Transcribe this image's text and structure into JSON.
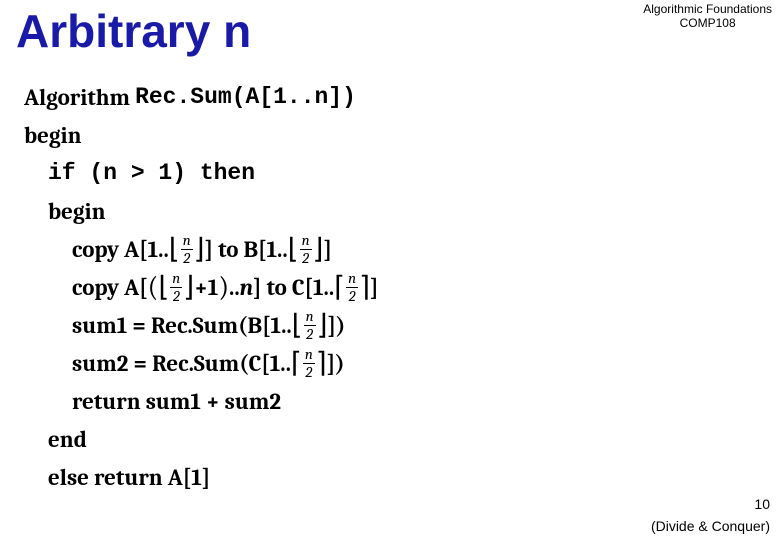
{
  "title": "Arbitrary n",
  "course": {
    "line1": "Algorithmic Foundations",
    "line2": "COMP108"
  },
  "algo": {
    "l0a": "Algorithm",
    "l0b": "Rec.Sum(A[1..n])",
    "l1": "begin",
    "l2a": "if (n > 1) then",
    "l3": "begin",
    "l4a": "copy A[1..",
    "l4b": "] to B[1..",
    "l4c": "]",
    "l5a": "copy A[",
    "l5b": "+1",
    "l5c": "..",
    "l5d": "] to C[1..",
    "l5e": "]",
    "l6a": "sum1 = Rec.Sum(B[1..",
    "l6b": "])",
    "l7a": "sum2 = Rec.Sum(C[1..",
    "l7b": "])",
    "l8": "return sum1 + sum2",
    "l9": "end",
    "l10": "else return A[1]",
    "frac_n": "n",
    "frac_2": "2",
    "var_n": "n"
  },
  "page_number": "10",
  "footer": "(Divide & Conquer)"
}
